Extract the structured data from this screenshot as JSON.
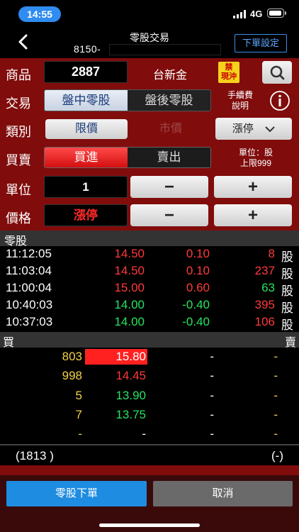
{
  "status_bar": {
    "time": "14:55",
    "network": "4G"
  },
  "header": {
    "title": "零股交易",
    "account_prefix": "8150-",
    "order_settings_label": "下單設定"
  },
  "form": {
    "product_label": "商品",
    "stock_code": "2887",
    "stock_name": "台新金",
    "badge_line1": "禁",
    "badge_line2": "現沖",
    "trade_label": "交易",
    "trade_options": [
      "盤中零股",
      "盤後零股"
    ],
    "fee_line1": "手續費",
    "fee_line2": "說明",
    "category_label": "類別",
    "category_options": [
      "限價",
      "市價"
    ],
    "price_type": "漲停",
    "buysell_label": "買賣",
    "buysell_options": [
      "買進",
      "賣出"
    ],
    "unit_info_line1": "單位：股",
    "unit_info_line2": "上限999",
    "unit_label": "單位",
    "unit_value": "1",
    "price_label": "價格",
    "price_value": "漲停",
    "minus": "−",
    "plus": "+"
  },
  "ticks": {
    "header": "零股",
    "rows": [
      {
        "time": "11:12:05",
        "price": "14.50",
        "change": "0.10",
        "volume": "8",
        "unit": "股"
      },
      {
        "time": "11:03:04",
        "price": "14.50",
        "change": "0.10",
        "volume": "237",
        "unit": "股"
      },
      {
        "time": "11:00:04",
        "price": "15.00",
        "change": "0.60",
        "volume": "63",
        "unit": "股"
      },
      {
        "time": "10:40:03",
        "price": "14.00",
        "change": "-0.40",
        "volume": "395",
        "unit": "股"
      },
      {
        "time": "10:37:03",
        "price": "14.00",
        "change": "-0.40",
        "volume": "106",
        "unit": "股"
      }
    ]
  },
  "book": {
    "buy_label": "買",
    "sell_label": "賣",
    "rows": [
      {
        "bid_qty": "803",
        "bid_price": "15.80",
        "ask_price": "-",
        "ask_qty": "-"
      },
      {
        "bid_qty": "998",
        "bid_price": "14.45",
        "ask_price": "-",
        "ask_qty": "-"
      },
      {
        "bid_qty": "5",
        "bid_price": "13.90",
        "ask_price": "-",
        "ask_qty": "-"
      },
      {
        "bid_qty": "7",
        "bid_price": "13.75",
        "ask_price": "-",
        "ask_qty": "-"
      },
      {
        "bid_qty": "-",
        "bid_price": "-",
        "ask_price": "-",
        "ask_qty": "-"
      }
    ],
    "total_bid": "(1813 )",
    "total_ask": "(-)"
  },
  "actions": {
    "submit_label": "零股下單",
    "cancel_label": "取消"
  },
  "colors": {
    "panel": "#800c0c",
    "accent_blue": "#1e8ce0",
    "up_red": "#ff3a3a",
    "down_green": "#27e35f",
    "qty_yellow": "#f2d14a"
  }
}
